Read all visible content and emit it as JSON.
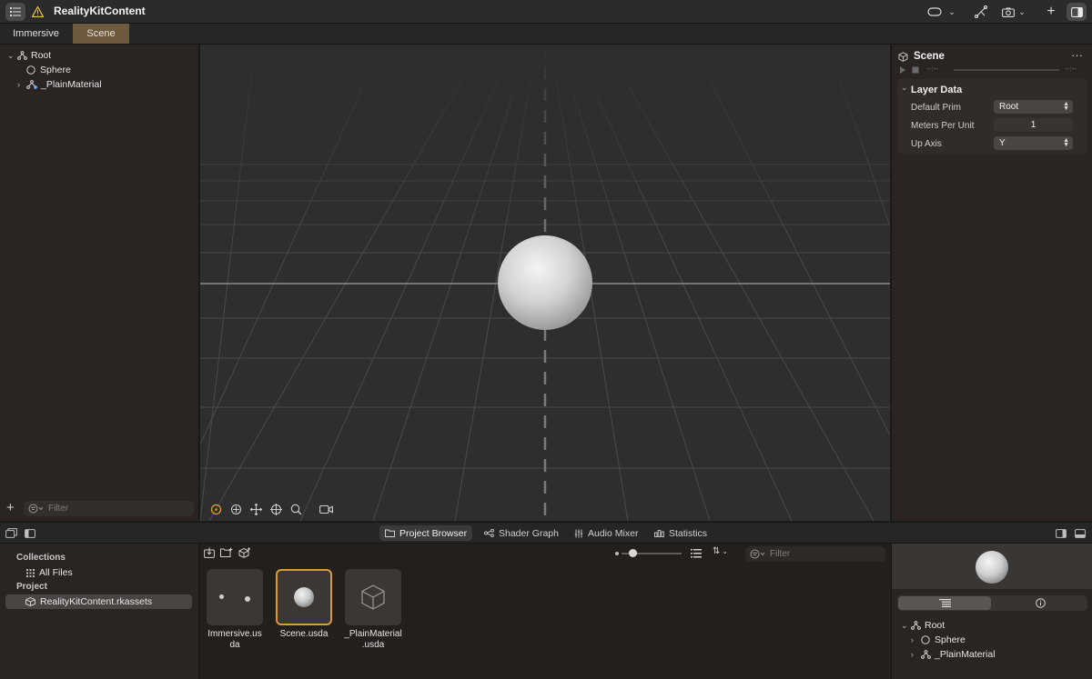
{
  "app": {
    "title": "RealityKitContent"
  },
  "tabs": [
    {
      "label": "Immersive",
      "active": false
    },
    {
      "label": "Scene",
      "active": true
    }
  ],
  "hierarchy": {
    "items": [
      {
        "label": "Root"
      },
      {
        "label": "Sphere"
      },
      {
        "label": "_PlainMaterial"
      }
    ],
    "filter_placeholder": "Filter"
  },
  "inspector": {
    "title": "Scene",
    "timecode_left": "--:--",
    "timecode_right": "--:--",
    "section": {
      "title": "Layer Data",
      "props": [
        {
          "label": "Default Prim",
          "value": "Root"
        },
        {
          "label": "Meters Per Unit",
          "value": "1"
        },
        {
          "label": "Up Axis",
          "value": "Y"
        }
      ]
    }
  },
  "bottom_tabs": [
    {
      "label": "Project Browser",
      "active": true
    },
    {
      "label": "Shader Graph",
      "active": false
    },
    {
      "label": "Audio Mixer",
      "active": false
    },
    {
      "label": "Statistics",
      "active": false
    }
  ],
  "project_nav": {
    "collections_heading": "Collections",
    "all_files": "All Files",
    "project_heading": "Project",
    "project_item": "RealityKitContent.rkassets"
  },
  "browser": {
    "filter_placeholder": "Filter",
    "assets": [
      {
        "line1": "Immersive.us",
        "line2": "da",
        "selected": false
      },
      {
        "line1": "Scene.usda",
        "line2": "",
        "selected": true
      },
      {
        "line1": "_PlainMaterial",
        "line2": ".usda",
        "selected": false
      }
    ]
  },
  "preview_tree": {
    "items": [
      {
        "label": "Root"
      },
      {
        "label": "Sphere"
      },
      {
        "label": "_PlainMaterial"
      }
    ]
  },
  "colors": {
    "accent": "#d89a3c",
    "tab_active": "#6e5a3c"
  }
}
